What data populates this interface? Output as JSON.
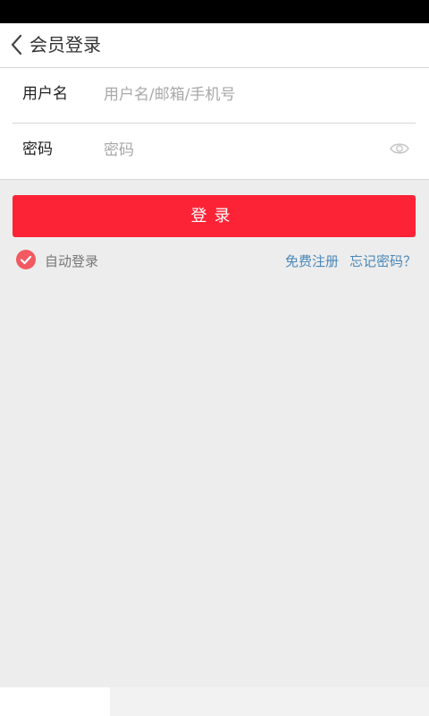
{
  "header": {
    "title": "会员登录",
    "back_icon": "chevron-left-icon"
  },
  "form": {
    "username": {
      "label": "用户名",
      "value": "",
      "placeholder": "用户名/邮箱/手机号"
    },
    "password": {
      "label": "密码",
      "value": "",
      "placeholder": "密码",
      "visibility_icon": "eye-icon"
    }
  },
  "actions": {
    "login_label": "登录",
    "auto_login_label": "自动登录",
    "auto_login_checked": true,
    "register_label": "免费注册",
    "forgot_label": "忘记密码？"
  },
  "colors": {
    "accent": "#fd2336",
    "check": "#f25a62",
    "link": "#4a88b8",
    "background": "#ededed"
  }
}
